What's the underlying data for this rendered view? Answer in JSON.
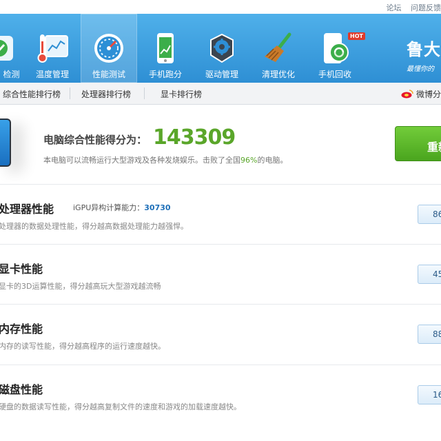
{
  "top_links": {
    "forum": "论坛",
    "feedback": "问题反馈"
  },
  "nav": [
    {
      "label": "检测",
      "icon": "hardware-check-icon"
    },
    {
      "label": "温度管理",
      "icon": "thermometer-icon"
    },
    {
      "label": "性能测试",
      "icon": "speedometer-icon"
    },
    {
      "label": "手机跑分",
      "icon": "phone-benchmark-icon"
    },
    {
      "label": "驱动管理",
      "icon": "driver-gear-icon"
    },
    {
      "label": "清理优化",
      "icon": "broom-icon"
    },
    {
      "label": "手机回收",
      "icon": "phone-recycle-icon",
      "badge": "HOT"
    }
  ],
  "brand": {
    "name": "鲁大",
    "slogan": "最懂你的"
  },
  "subnav": {
    "tabs": [
      "综合性能排行榜",
      "处理器排行榜",
      "显卡排行榜"
    ],
    "weibo": "微博分"
  },
  "summary": {
    "title": "电脑综合性能得分为：",
    "score": "143309",
    "desc_before": "本电脑可以流畅运行大型游戏及各种发烧娱乐。击败了全国",
    "percent": "96%",
    "desc_after": "的电脑。",
    "retest": "重新"
  },
  "rows": [
    {
      "title": "处理器性能",
      "desc": "处理器的数据处理性能，得分越高数据处理能力越强悍。",
      "score": "86",
      "gpu_label": "iGPU异构计算能力：",
      "gpu_value": "30730"
    },
    {
      "title": "显卡性能",
      "desc": "显卡的3D运算性能，得分越高玩大型游戏越流畅",
      "score": "45"
    },
    {
      "title": "内存性能",
      "desc": "内存的读写性能，得分越高程序的运行速度越快。",
      "score": "88"
    },
    {
      "title": "磁盘性能",
      "desc": "硬盘的数据读写性能，得分越高复制文件的速度和游戏的加载速度越快。",
      "score": "16"
    }
  ],
  "colors": {
    "header": "#3a9de0",
    "accent_green": "#5aa62a",
    "score_blue": "#1d6fb8"
  }
}
